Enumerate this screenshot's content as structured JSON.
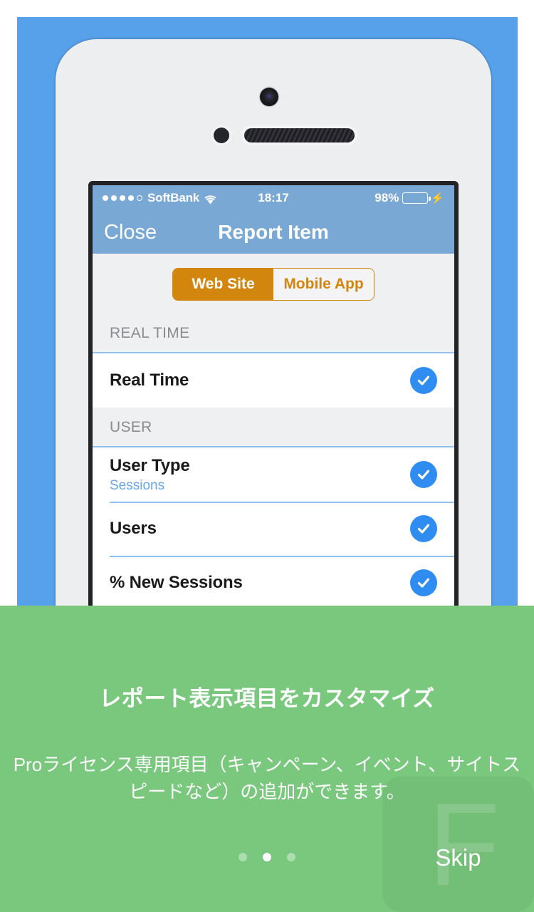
{
  "colors": {
    "hero_blue": "#57a0ea",
    "hero_green": "#7ac87e",
    "accent_orange": "#d2860e",
    "check_blue": "#2f8cf0",
    "separator_blue": "#8ec0f0",
    "navbar_blue": "#7aa8d4",
    "battery_green": "#4cd964"
  },
  "phone": {
    "statusbar": {
      "signal_dots_filled": 4,
      "signal_dots_total": 5,
      "carrier": "SoftBank",
      "wifi_icon": "wifi-icon",
      "time": "18:17",
      "battery_percent": "98%",
      "battery_level": 98,
      "charging_icon": "lightning-bolt-icon"
    },
    "navbar": {
      "close_label": "Close",
      "title": "Report Item"
    },
    "segmented_control": {
      "options": [
        {
          "label": "Web Site",
          "selected": true
        },
        {
          "label": "Mobile App",
          "selected": false
        }
      ]
    },
    "sections": [
      {
        "header": "REAL TIME",
        "rows": [
          {
            "title": "Real Time",
            "subtitle": "",
            "checked": true
          }
        ]
      },
      {
        "header": "USER",
        "rows": [
          {
            "title": "User Type",
            "subtitle": "Sessions",
            "checked": true
          },
          {
            "title": "Users",
            "subtitle": "",
            "checked": true
          },
          {
            "title": "% New Sessions",
            "subtitle": "",
            "checked": true
          }
        ]
      }
    ]
  },
  "onboarding": {
    "title": "レポート表示項目をカスタマイズ",
    "description": "Proライセンス専用項目（キャンペーン、イベント、サイトスピードなど）の追加ができます。",
    "skip_label": "Skip",
    "watermark_letter": "F",
    "page_dots": {
      "total": 3,
      "active_index": 1
    }
  }
}
